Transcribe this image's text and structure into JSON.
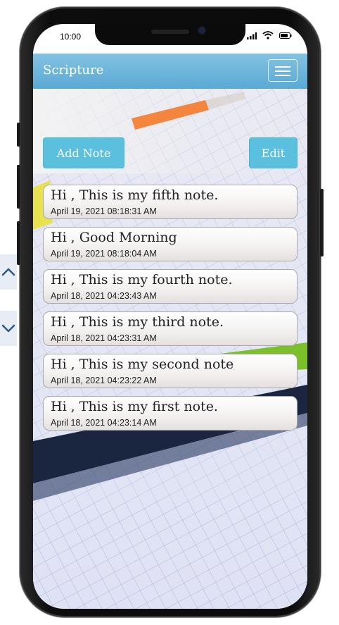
{
  "status_bar": {
    "time": "10:00"
  },
  "app": {
    "title": "Scripture"
  },
  "actions": {
    "add_note": "Add Note",
    "edit": "Edit"
  },
  "notes": [
    {
      "title": "Hi , This is my fifth note.",
      "date": "April 19, 2021 08:18:31 AM"
    },
    {
      "title": "Hi , Good Morning",
      "date": "April 19, 2021 08:18:04 AM"
    },
    {
      "title": "Hi , This is my fourth note.",
      "date": "April 18, 2021 04:23:43 AM"
    },
    {
      "title": "Hi , This is my third note.",
      "date": "April 18, 2021 04:23:31 AM"
    },
    {
      "title": "Hi , This is my second note",
      "date": "April 18, 2021 04:23:22 AM"
    },
    {
      "title": "Hi , This is my first note.",
      "date": "April 18, 2021 04:23:14 AM"
    }
  ],
  "colors": {
    "navbar": "#6fb7dc",
    "button": "#5bc0de",
    "scroll_control": "#e8ecf5",
    "chevron": "#2d5b86"
  },
  "icons": {
    "menu": "hamburger-icon",
    "scroll_up": "chevron-up-icon",
    "scroll_down": "chevron-down-icon"
  }
}
